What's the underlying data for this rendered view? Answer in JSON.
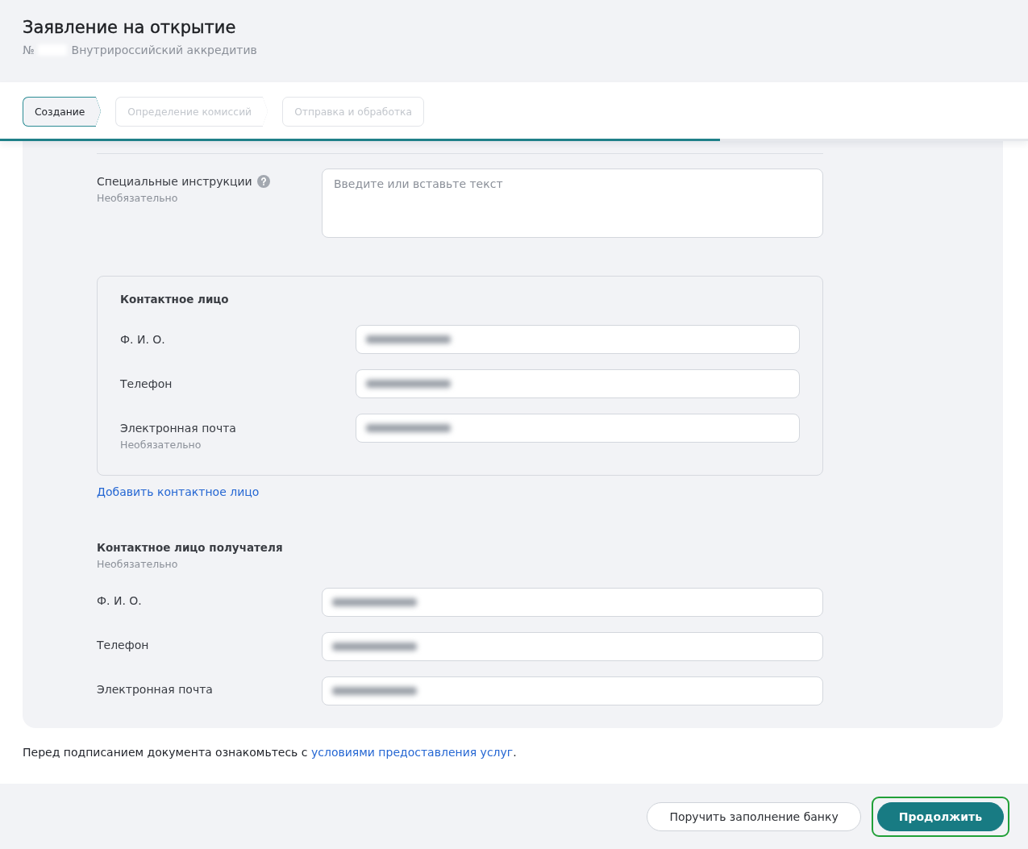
{
  "header": {
    "title": "Заявление на открытие",
    "number_sign": "№",
    "number_redacted": true,
    "subtitle": "Внутрироссийский аккредитив"
  },
  "steps": [
    {
      "label": "Создание",
      "selected": true
    },
    {
      "label": "Определение комиссий",
      "selected": false
    },
    {
      "label": "Отправка и обработка",
      "selected": false
    }
  ],
  "progress": {
    "level": 0.7
  },
  "instructions": {
    "label": "Специальные инструкции",
    "help": true,
    "hint": "Необязательно",
    "placeholder": "Введите или вставьте текст"
  },
  "contact": {
    "title": "Контактное лицо",
    "fields": [
      {
        "label": "Ф. И. О.",
        "redacted": true
      },
      {
        "label": "Телефон",
        "redacted": true
      },
      {
        "label": "Электронная почта",
        "hint": "Необязательно",
        "redacted": true
      }
    ],
    "add_link": "Добавить контактное лицо"
  },
  "recipient_contact": {
    "title": "Контактное лицо получателя",
    "hint": "Необязательно",
    "fields": [
      {
        "label": "Ф. И. О.",
        "redacted": true
      },
      {
        "label": "Телефон",
        "redacted": true
      },
      {
        "label": "Электронная почта",
        "redacted": true
      }
    ]
  },
  "terms": {
    "text": "Перед подписанием документа ознакомьтесь с ",
    "link": "условиями предоставления услуг",
    "end": "."
  },
  "actions": [
    {
      "label": "Поручить заполнение банку",
      "kind": "secondary",
      "focused": false
    },
    {
      "label": "Продолжить",
      "kind": "primary",
      "focused": true
    }
  ]
}
